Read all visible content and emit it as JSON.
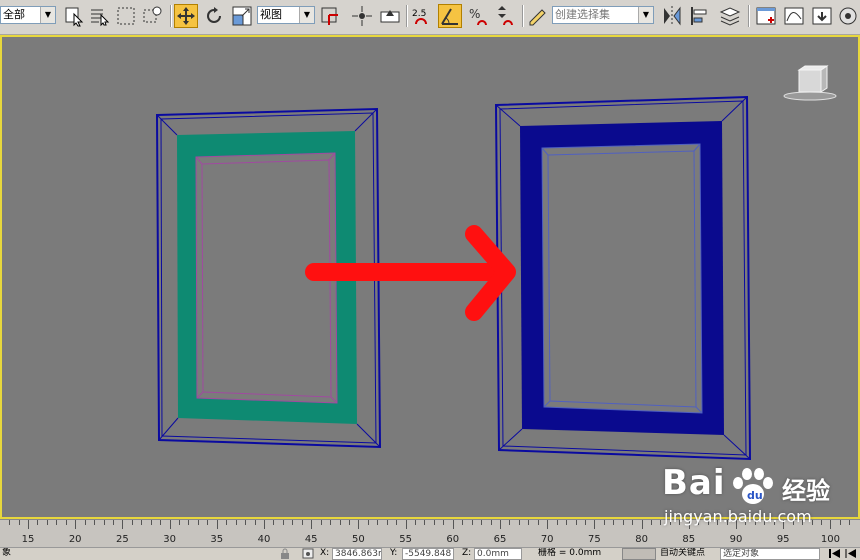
{
  "toolbar": {
    "selection_filter": "全部",
    "ref_coord_system": "视图",
    "snap_value": "2.5",
    "named_selection_placeholder": "创建选择集"
  },
  "timeline": {
    "ticks": [
      15,
      20,
      25,
      30,
      35,
      40,
      45,
      50,
      55,
      60,
      65,
      70,
      75,
      80,
      85,
      90,
      95,
      100
    ]
  },
  "status": {
    "left_text": "象",
    "x_label": "X:",
    "x_value": "3846.863m",
    "y_label": "Y:",
    "y_value": "-5549.848",
    "z_label": "Z:",
    "z_value": "0.0mm",
    "grid_text": "栅格 = 0.0mm",
    "autokey_label": "自动关键点",
    "set_key_mode": "选定对象"
  },
  "watermark": {
    "logo": "Bai",
    "brand_cn": "经验",
    "url": "jingyan.baidu.com"
  },
  "colors": {
    "viewport_bg": "#7b7b7b",
    "viewport_border": "#e7d73c",
    "left_frame_fill": "#0e8a72",
    "right_frame_fill": "#0a0a8e",
    "wire_blue": "#0a0aa0",
    "arrow_red": "#ff1010"
  }
}
